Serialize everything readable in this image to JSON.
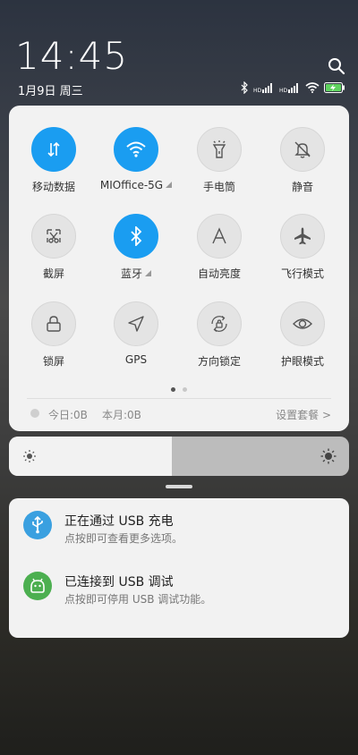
{
  "header": {
    "time": "14:45",
    "date": "1月9日 周三"
  },
  "quick_tiles": [
    {
      "label": "移动数据",
      "icon": "mobile-data-icon",
      "active": true
    },
    {
      "label": "MIOffice-5G",
      "icon": "wifi-icon",
      "active": true,
      "expand": true
    },
    {
      "label": "手电筒",
      "icon": "flashlight-icon",
      "active": false
    },
    {
      "label": "静音",
      "icon": "mute-bell-icon",
      "active": false
    },
    {
      "label": "截屏",
      "icon": "screenshot-icon",
      "active": false
    },
    {
      "label": "蓝牙",
      "icon": "bluetooth-icon",
      "active": true,
      "expand": true
    },
    {
      "label": "自动亮度",
      "icon": "auto-brightness-icon",
      "active": false
    },
    {
      "label": "飞行模式",
      "icon": "airplane-icon",
      "active": false
    },
    {
      "label": "锁屏",
      "icon": "lock-icon",
      "active": false
    },
    {
      "label": "GPS",
      "icon": "gps-icon",
      "active": false
    },
    {
      "label": "方向锁定",
      "icon": "rotation-lock-icon",
      "active": false
    },
    {
      "label": "护眼模式",
      "icon": "eye-icon",
      "active": false
    }
  ],
  "usage": {
    "today": "今日:0B",
    "month": "本月:0B",
    "settings": "设置套餐 >"
  },
  "brightness": {
    "level": 0.48
  },
  "notifications": [
    {
      "title": "正在通过 USB 充电",
      "subtitle": "点按即可查看更多选项。",
      "icon": "usb-icon",
      "color": "#3aa0e0"
    },
    {
      "title": "已连接到 USB 调试",
      "subtitle": "点按即可停用 USB 调试功能。",
      "icon": "android-icon",
      "color": "#4caf50"
    }
  ],
  "colors": {
    "accent": "#1a9df1",
    "panel": "#f2f2f2"
  }
}
